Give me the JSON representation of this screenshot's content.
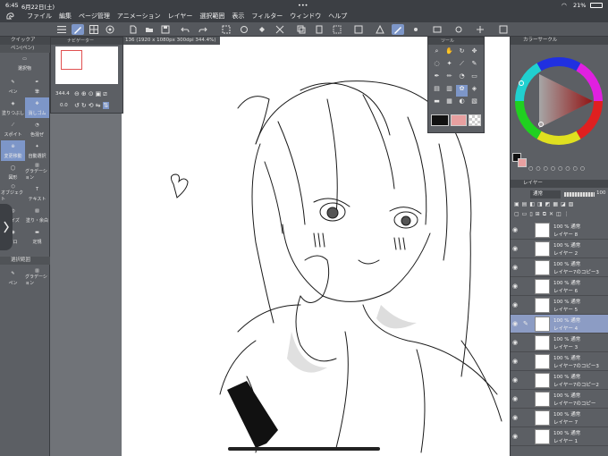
{
  "status": {
    "time": "6:45",
    "date": "6月22日(土)",
    "dots": "•••",
    "battery": "21%"
  },
  "menu": [
    "ファイル",
    "編集",
    "ページ管理",
    "アニメーション",
    "レイヤー",
    "選択範囲",
    "表示",
    "フィルター",
    "ウィンドウ",
    "ヘルプ"
  ],
  "canvas": {
    "title": "136 (1920 x 1080px 300dpi 344.4%)"
  },
  "navigator": {
    "title": "ナビゲーター",
    "zoom": "344.4",
    "rotation": "0.0"
  },
  "subtool": {
    "title": "ツール"
  },
  "left": {
    "header": "クイックア",
    "header2": "ペン(ペン)",
    "tools": [
      {
        "label": "選択物"
      },
      {
        "label": "ペン"
      },
      {
        "label": "筆"
      },
      {
        "label": "塗りつぶし"
      },
      {
        "label": "消しゴム"
      },
      {
        "label": "スポイト"
      },
      {
        "label": "色混ぜ"
      },
      {
        "label": "自動選択"
      },
      {
        "label": "変更移動"
      },
      {
        "label": "図形"
      },
      {
        "label": "グラデーション"
      },
      {
        "label": "オブジェクト"
      },
      {
        "label": "テキスト"
      },
      {
        "label": "サイズ"
      },
      {
        "label": "塗り・余白"
      },
      {
        "label": "ブロ"
      },
      {
        "label": "定規"
      }
    ],
    "lower_header": "選択範囲",
    "lower_tools": [
      {
        "label": "ペン"
      },
      {
        "label": "グラデーション"
      }
    ]
  },
  "right": {
    "color_header": "カラーサークル",
    "layer_header": "レイヤー",
    "blend": "通常",
    "opacity": "100",
    "layers": [
      {
        "pct": "100 % 通常",
        "name": "レイヤー 8"
      },
      {
        "pct": "100 % 通常",
        "name": "レイヤー 2"
      },
      {
        "pct": "100 % 通常",
        "name": "レイヤー7のコピー3"
      },
      {
        "pct": "100 % 通常",
        "name": "レイヤー 6"
      },
      {
        "pct": "100 % 通常",
        "name": "レイヤー 5"
      },
      {
        "pct": "100 % 通常",
        "name": "レイヤー 4"
      },
      {
        "pct": "100 % 通常",
        "name": "レイヤー 3"
      },
      {
        "pct": "100 % 通常",
        "name": "レイヤー7のコピー3"
      },
      {
        "pct": "100 % 通常",
        "name": "レイヤー7のコピー2"
      },
      {
        "pct": "100 % 通常",
        "name": "レイヤー7のコピー"
      },
      {
        "pct": "100 % 通常",
        "name": "レイヤー 7"
      },
      {
        "pct": "100 % 通常",
        "name": "レイヤー 1"
      }
    ]
  },
  "colors": {
    "accent": "#7d96c8",
    "main": "#111111",
    "sub": "#e8a0a0"
  }
}
